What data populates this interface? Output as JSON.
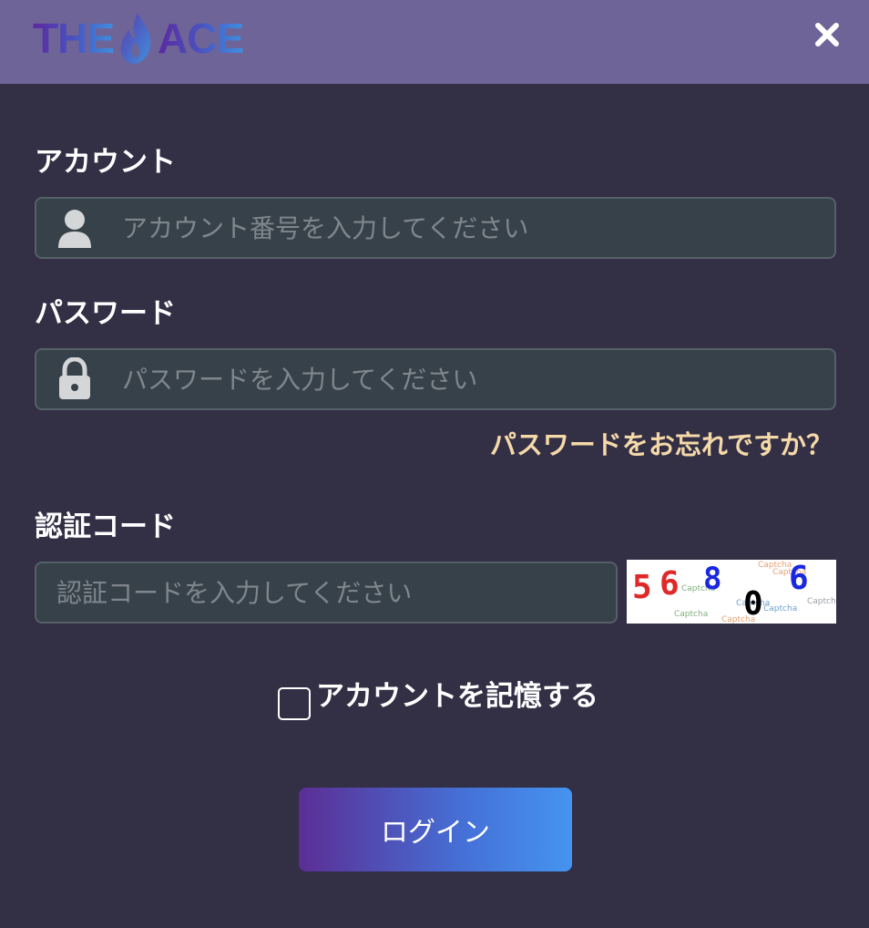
{
  "header": {
    "logo_left": "THE",
    "logo_right": "ACE",
    "close_icon": "close-icon"
  },
  "account": {
    "label": "アカウント",
    "placeholder": "アカウント番号を入力してください",
    "value": "",
    "icon": "user-icon"
  },
  "password": {
    "label": "パスワード",
    "placeholder": "パスワードを入力してください",
    "value": "",
    "icon": "lock-icon"
  },
  "forgot_password": "パスワードをお忘れですか？",
  "verification": {
    "label": "認証コード",
    "placeholder": "認証コードを入力してください",
    "value": "",
    "captcha_digits": [
      "5",
      "6",
      "8",
      "0",
      "6"
    ],
    "captcha_noise": "Captcha"
  },
  "remember": {
    "label": "アカウントを記憶する",
    "checked": false
  },
  "login_button": "ログイン",
  "colors": {
    "background": "#332f45",
    "header": "#6e6497",
    "field_bg": "#37414a",
    "accent_link": "#f5d9a8",
    "button_start": "#5b2e95",
    "button_end": "#4594f0"
  }
}
